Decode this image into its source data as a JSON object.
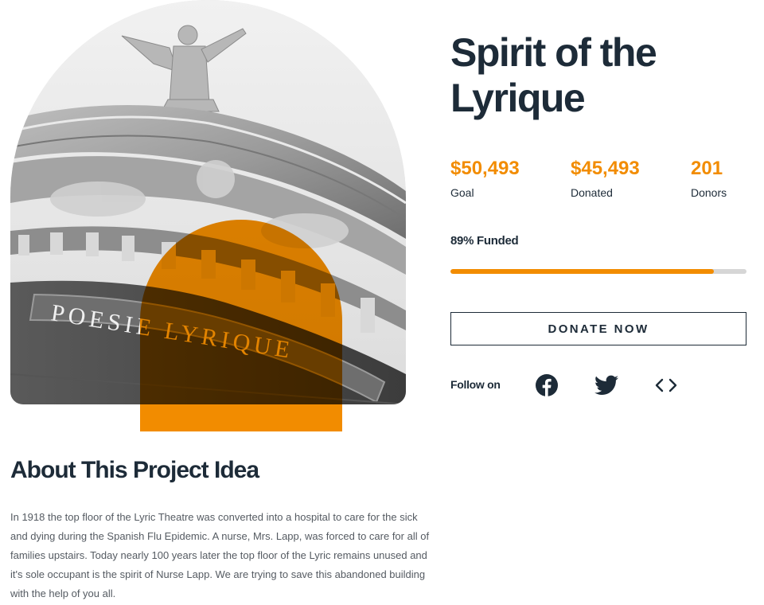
{
  "project": {
    "title": "Spirit of the Lyrique"
  },
  "hero": {
    "inscription": "POESIE LYRIQUE"
  },
  "stats": [
    {
      "value": "$50,493",
      "label": "Goal"
    },
    {
      "value": "$45,493",
      "label": "Donated"
    },
    {
      "value": "201",
      "label": "Donors"
    }
  ],
  "funding": {
    "label": "89% Funded",
    "percent": 89
  },
  "donate": {
    "label": "DONATE NOW"
  },
  "follow": {
    "label": "Follow on",
    "icons": [
      "facebook-icon",
      "twitter-icon",
      "embed-code-icon"
    ]
  },
  "about": {
    "title": "About This Project Idea",
    "body": "In 1918 the top floor of the Lyric Theatre was converted into a hospital to care for the sick and dying during the Spanish Flu Epidemic. A nurse, Mrs. Lapp, was forced to care for all of families upstairs. Today nearly 100 years later the top floor of the Lyric remains unused and it's sole occupant is the spirit of Nurse Lapp. We are trying to save this abandoned building with the help of you all."
  },
  "colors": {
    "accent": "#f28c00",
    "text": "#1d2b38",
    "muted": "#555b62",
    "track": "#d6d6d6"
  }
}
